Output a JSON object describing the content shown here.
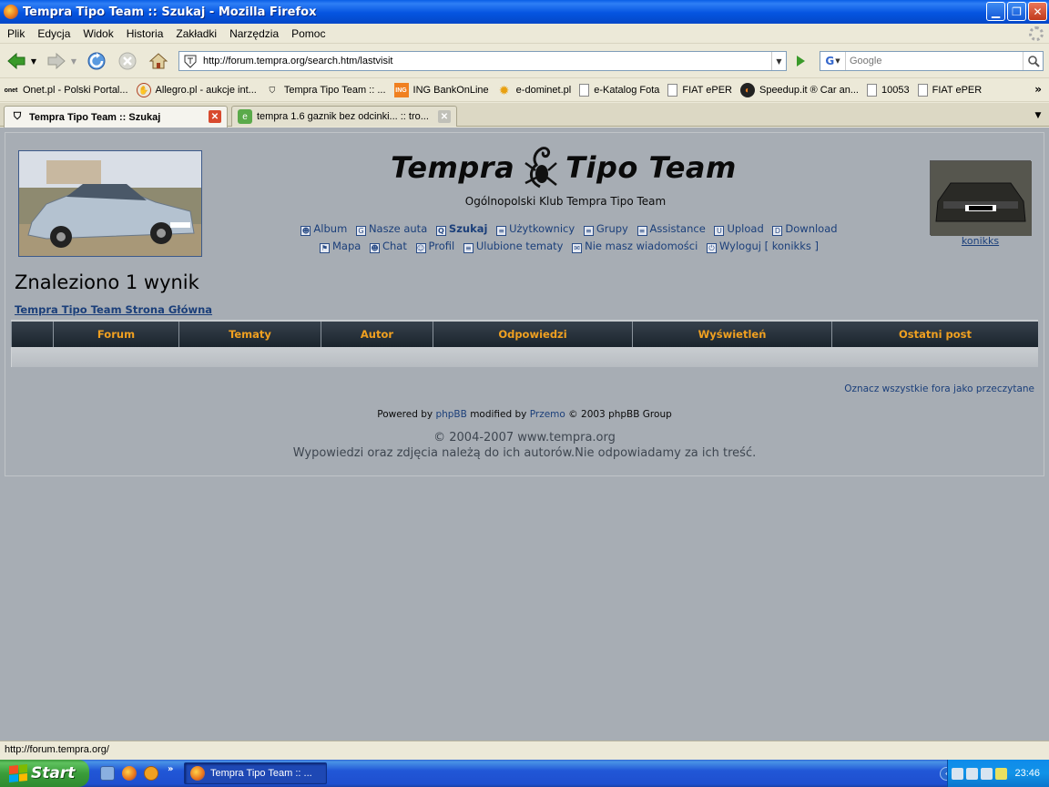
{
  "window": {
    "title": "Tempra Tipo Team :: Szukaj - Mozilla Firefox"
  },
  "menu": [
    "Plik",
    "Edycja",
    "Widok",
    "Historia",
    "Zakładki",
    "Narzędzia",
    "Pomoc"
  ],
  "navbar": {
    "url": "http://forum.tempra.org/search.htm/lastvisit",
    "search_placeholder": "Google"
  },
  "bookmarks": [
    {
      "label": "Onet.pl - Polski Portal...",
      "icon": "onet-icon"
    },
    {
      "label": "Allegro.pl - aukcje int...",
      "icon": "allegro-icon"
    },
    {
      "label": "Tempra Tipo Team :: ...",
      "icon": "tempra-icon"
    },
    {
      "label": "ING BankOnLine",
      "icon": "ing-icon"
    },
    {
      "label": "e-dominet.pl",
      "icon": "sun-icon"
    },
    {
      "label": "e-Katalog Fota",
      "icon": "page-icon"
    },
    {
      "label": "FIAT ePER",
      "icon": "page-icon"
    },
    {
      "label": "Speedup.it ® Car an...",
      "icon": "speedup-icon"
    },
    {
      "label": "10053",
      "icon": "page-icon"
    },
    {
      "label": "FIAT ePER",
      "icon": "page-icon"
    }
  ],
  "tabs": [
    {
      "label": "Tempra Tipo Team :: Szukaj",
      "active": true
    },
    {
      "label": "tempra 1.6 gaznik bez odcinki... :: tro...",
      "active": false
    }
  ],
  "forum": {
    "logo_left": "Tempra",
    "logo_right": "Tipo Team",
    "subtitle": "Ogólnopolski Klub Tempra Tipo Team",
    "nav_row1": [
      {
        "label": "Album",
        "icon": "album-icon"
      },
      {
        "label": "Nasze auta",
        "icon": "car-icon"
      },
      {
        "label": "Szukaj",
        "icon": "search-icon",
        "bold": true
      },
      {
        "label": "Użytkownicy",
        "icon": "users-icon"
      },
      {
        "label": "Grupy",
        "icon": "groups-icon"
      },
      {
        "label": "Assistance",
        "icon": "assistance-icon"
      },
      {
        "label": "Upload",
        "icon": "upload-icon"
      },
      {
        "label": "Download",
        "icon": "download-icon"
      }
    ],
    "nav_row2": [
      {
        "label": "Mapa",
        "icon": "map-icon"
      },
      {
        "label": "Chat",
        "icon": "chat-icon"
      },
      {
        "label": "Profil",
        "icon": "profile-icon"
      },
      {
        "label": "Ulubione tematy",
        "icon": "favorites-icon"
      },
      {
        "label": "Nie masz wiadomości",
        "icon": "messages-icon"
      },
      {
        "label": "Wyloguj [ konikks ]",
        "icon": "logout-icon"
      }
    ],
    "avatar_name": "konikks",
    "heading": "Znaleziono 1 wynik",
    "breadcrumb": "Tempra Tipo Team Strona Główna",
    "table_headers": [
      "",
      "Forum",
      "Tematy",
      "Autor",
      "Odpowiedzi",
      "Wyświetleń",
      "Ostatni post"
    ],
    "mark_all": "Oznacz wszystkie fora jako przeczytane",
    "powered": {
      "prefix": "Powered by",
      "phpbb": "phpBB",
      "mid": "modified by",
      "przemo": "Przemo",
      "suffix": "© 2003 phpBB Group"
    },
    "copyright": "© 2004-2007 www.tempra.org",
    "disclaimer": "Wypowiedzi oraz zdjęcia należą do ich autorów.Nie odpowiadamy za ich treść."
  },
  "status": {
    "text": "http://forum.tempra.org/"
  },
  "taskbar": {
    "start": "Start",
    "items": [
      {
        "label": "Tempra Tipo Team :: ..."
      }
    ],
    "clock": "23:46"
  }
}
